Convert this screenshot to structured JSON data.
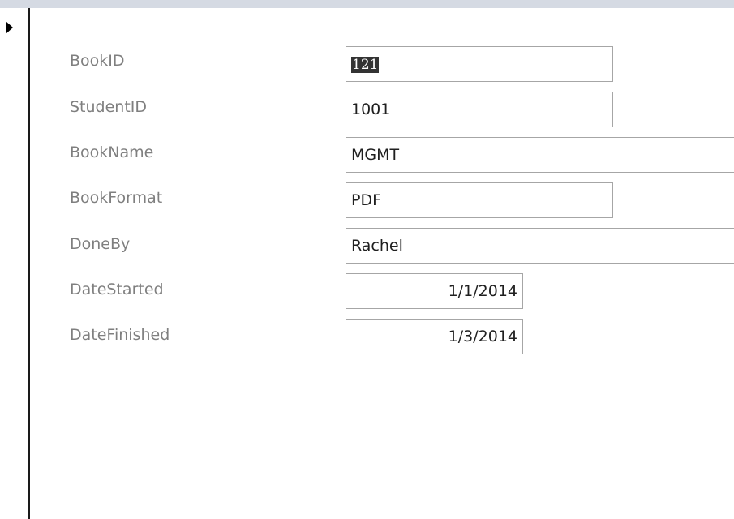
{
  "form": {
    "fields": [
      {
        "label": "BookID",
        "value": "121"
      },
      {
        "label": "StudentID",
        "value": "1001"
      },
      {
        "label": "BookName",
        "value": "MGMT"
      },
      {
        "label": "BookFormat",
        "value": "PDF"
      },
      {
        "label": "DoneBy",
        "value": "Rachel"
      },
      {
        "label": "DateStarted",
        "value": "1/1/2014"
      },
      {
        "label": "DateFinished",
        "value": "1/3/2014"
      }
    ]
  },
  "colors": {
    "label_text": "#7f7f7f",
    "input_border": "#a6a6a6",
    "selection_bg": "#333333",
    "top_bar": "#d5dae3"
  },
  "icons": {
    "record_selector": "triangle-right-icon"
  }
}
